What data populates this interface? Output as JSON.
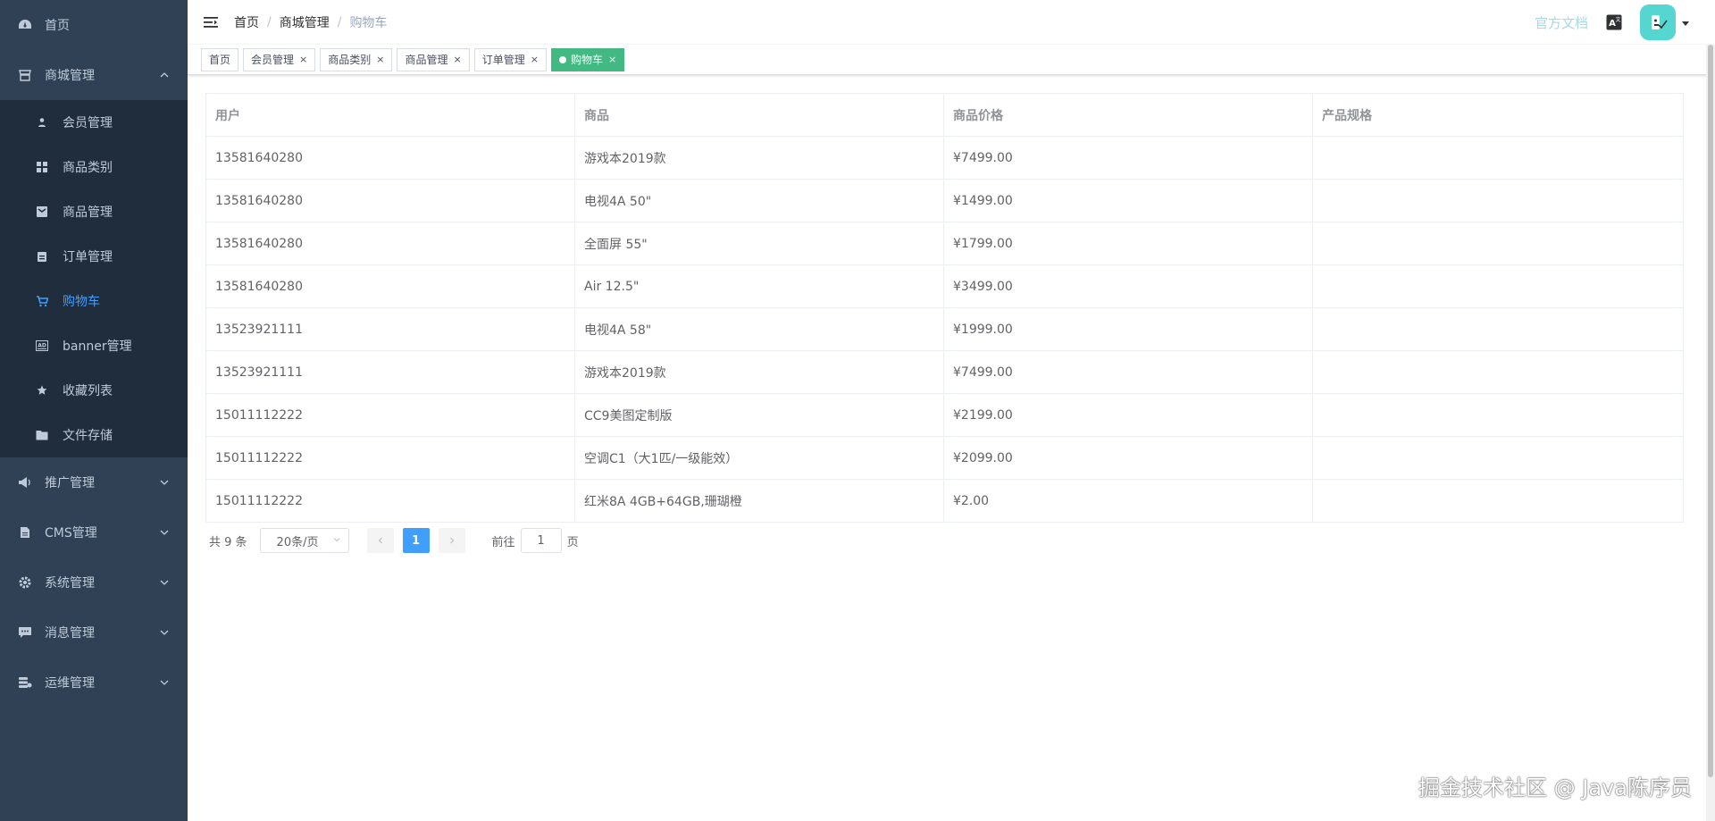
{
  "sidebar": {
    "home": "首页",
    "mall": "商城管理",
    "mall_items": [
      {
        "label": "会员管理",
        "icon": "user-icon"
      },
      {
        "label": "商品类别",
        "icon": "grid-icon"
      },
      {
        "label": "商品管理",
        "icon": "product-icon"
      },
      {
        "label": "订单管理",
        "icon": "clipboard-icon"
      },
      {
        "label": "购物车",
        "icon": "cart-icon",
        "active": true
      },
      {
        "label": "banner管理",
        "icon": "ad-icon"
      },
      {
        "label": "收藏列表",
        "icon": "star-icon"
      },
      {
        "label": "文件存储",
        "icon": "folder-icon"
      }
    ],
    "promotion": "推广管理",
    "cms": "CMS管理",
    "system": "系统管理",
    "message": "消息管理",
    "ops": "运维管理",
    "bg_color": "#304156",
    "active_color": "#409eff"
  },
  "navbar": {
    "breadcrumb": [
      "首页",
      "商城管理",
      "购物车"
    ],
    "doc_link": "官方文档"
  },
  "tags": [
    {
      "label": "首页",
      "closable": false
    },
    {
      "label": "会员管理",
      "closable": true
    },
    {
      "label": "商品类别",
      "closable": true
    },
    {
      "label": "商品管理",
      "closable": true
    },
    {
      "label": "订单管理",
      "closable": true
    },
    {
      "label": "购物车",
      "closable": true,
      "active": true
    }
  ],
  "table": {
    "headers": [
      "用户",
      "商品",
      "商品价格",
      "产品规格"
    ],
    "rows": [
      [
        "13581640280",
        "游戏本2019款",
        "¥7499.00",
        ""
      ],
      [
        "13581640280",
        "电视4A 50\"",
        "¥1499.00",
        ""
      ],
      [
        "13581640280",
        "全面屏 55\"",
        "¥1799.00",
        ""
      ],
      [
        "13581640280",
        "Air 12.5\"",
        "¥3499.00",
        ""
      ],
      [
        "13523921111",
        "电视4A 58\"",
        "¥1999.00",
        ""
      ],
      [
        "13523921111",
        "游戏本2019款",
        "¥7499.00",
        ""
      ],
      [
        "15011112222",
        "CC9美图定制版",
        "¥2199.00",
        ""
      ],
      [
        "15011112222",
        "空调C1（大1匹/一级能效）",
        "¥2099.00",
        ""
      ],
      [
        "15011112222",
        "红米8A 4GB+64GB,珊瑚橙",
        "¥2.00",
        ""
      ]
    ]
  },
  "pagination": {
    "total": "共 9 条",
    "page_size": "20条/页",
    "current_page": "1",
    "goto_label": "前往",
    "goto_value": "1",
    "page_unit": "页"
  },
  "watermark": "掘金技术社区 @ Java陈序员"
}
